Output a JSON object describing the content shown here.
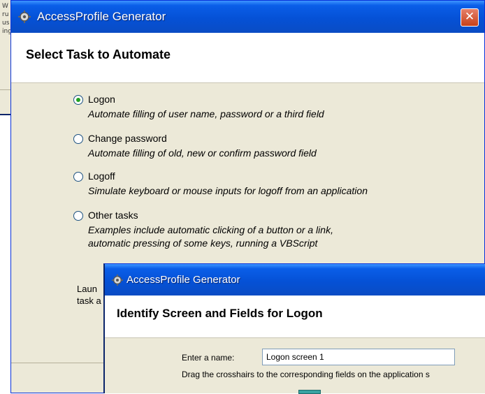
{
  "background_window": {
    "text_lines": [
      "W",
      "ru",
      "us",
      "ing"
    ]
  },
  "main_dialog": {
    "title": "AccessProfile Generator",
    "heading": "Select Task to Automate",
    "close_glyph": "✕",
    "options": [
      {
        "label": "Logon",
        "description": [
          "Automate filling of user name, password or a third field"
        ],
        "checked": true
      },
      {
        "label": "Change password",
        "description": [
          "Automate filling of old, new or confirm password field"
        ],
        "checked": false
      },
      {
        "label": "Logoff",
        "description": [
          "Simulate keyboard or mouse inputs for logoff from an application"
        ],
        "checked": false
      },
      {
        "label": "Other tasks",
        "description": [
          "Examples include automatic clicking of a button or a link,",
          "automatic pressing of some keys, running a VBScript"
        ],
        "checked": false
      }
    ],
    "launch_text": [
      "Laun",
      "task a"
    ]
  },
  "second_dialog": {
    "title": "AccessProfile Generator",
    "heading": "Identify Screen and Fields for Logon",
    "name_label": "Enter a name:",
    "name_value": "Logon screen 1",
    "drag_hint": "Drag the crosshairs to the corresponding fields on the application s"
  },
  "colors": {
    "titlebar": "#0551d6",
    "dialog_body": "#ece9d8",
    "close_button": "#c84119",
    "radio_selected": "#21a121"
  },
  "icons": [
    "app-gear-icon",
    "close-icon",
    "crosshair-icon"
  ]
}
